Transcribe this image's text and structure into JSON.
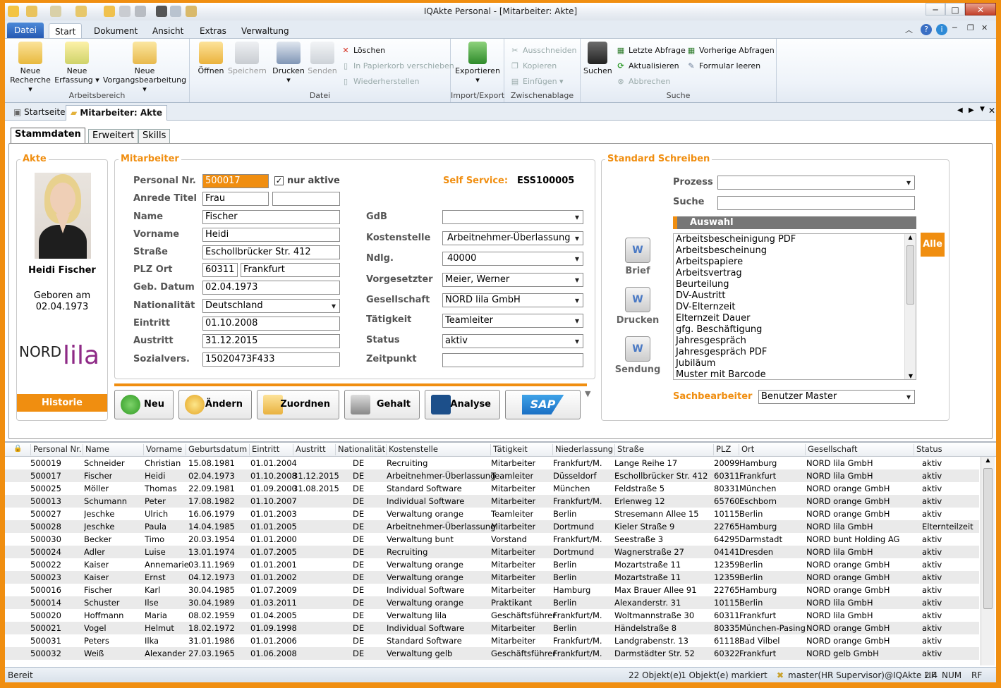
{
  "window": {
    "title": "IQAkte Personal - [Mitarbeiter: Akte]"
  },
  "ribbon_tabs": [
    "Datei",
    "Start",
    "Dokument",
    "Ansicht",
    "Extras",
    "Verwaltung"
  ],
  "ribbon": {
    "arbeitsbereich": {
      "label": "Arbeitsbereich",
      "neue_recherche": [
        "Neue",
        "Recherche"
      ],
      "neue_erfassung": [
        "Neue",
        "Erfassung"
      ],
      "neue_vorgang": [
        "Neue",
        "Vorgangsbearbeitung"
      ]
    },
    "datei": {
      "label": "Datei",
      "oeffnen": "Öffnen",
      "speichern": "Speichern",
      "drucken": "Drucken",
      "senden": "Senden",
      "loeschen": "Löschen",
      "papierkorb": "In Papierkorb verschieben",
      "wiederherstellen": "Wiederherstellen"
    },
    "import": {
      "label": "Import/Export",
      "exportieren": "Exportieren"
    },
    "zwischenablage": {
      "label": "Zwischenablage",
      "ausschneiden": "Ausschneiden",
      "kopieren": "Kopieren",
      "einfuegen": "Einfügen"
    },
    "suche": {
      "label": "Suche",
      "suchen": "Suchen",
      "letzte": "Letzte Abfrage",
      "aktualisieren": "Aktualisieren",
      "abbrechen": "Abbrechen",
      "vorherige": "Vorherige Abfragen",
      "leeren": "Formular leeren"
    }
  },
  "doc_tabs": [
    "Startseite",
    "Mitarbeiter: Akte"
  ],
  "sub_tabs": [
    "Stammdaten",
    "Erweitert",
    "Skills"
  ],
  "akte": {
    "title": "Akte",
    "name": "Heidi Fischer",
    "born_label": "Geboren am",
    "born_date": "02.04.1973",
    "logo_a": "NORD",
    "logo_b": "lila",
    "historie": "Historie"
  },
  "mitarbeiter": {
    "title": "Mitarbeiter",
    "labels": {
      "pnr": "Personal Nr.",
      "anrede": "Anrede Titel",
      "name": "Name",
      "vorname": "Vorname",
      "strasse": "Straße",
      "plz": "PLZ Ort",
      "geb": "Geb. Datum",
      "nat": "Nationalität",
      "eintritt": "Eintritt",
      "austritt": "Austritt",
      "sv": "Sozialvers.",
      "gdb": "GdB",
      "kst": "Kostenstelle",
      "ndlg": "Ndlg.",
      "vorg": "Vorgesetzter",
      "ges": "Gesellschaft",
      "taet": "Tätigkeit",
      "status": "Status",
      "zeit": "Zeitpunkt",
      "nur_aktive": "nur aktive",
      "self_service": "Self Service:"
    },
    "values": {
      "pnr": "500017",
      "anrede": "Frau",
      "titel": "",
      "name": "Fischer",
      "vorname": "Heidi",
      "strasse": "Eschollbrücker Str. 412",
      "plz": "60311",
      "ort": "Frankfurt",
      "geb": "02.04.1973",
      "nat": "Deutschland",
      "eintritt": "01.10.2008",
      "austritt": "31.12.2015",
      "sv": "15020473F433",
      "gdb": "",
      "kst": "Arbeitnehmer-Überlassung",
      "ndlg": "40000",
      "vorg": "Meier, Werner",
      "ges": "NORD lila GmbH",
      "taet": "Teamleiter",
      "status": "aktiv",
      "zeit": "",
      "ess": "ESS100005"
    }
  },
  "actions": {
    "neu": "Neu",
    "aendern": "Ändern",
    "zuordnen": "Zuordnen",
    "gehalt": "Gehalt",
    "analyse": "Analyse",
    "sap": "SAP"
  },
  "schreiben": {
    "title": "Standard Schreiben",
    "prozess_label": "Prozess",
    "suche_label": "Suche",
    "auswahl": "Auswahl",
    "alle": "Alle",
    "brief": "Brief",
    "drucken": "Drucken",
    "sendung": "Sendung",
    "sb_label": "Sachbearbeiter",
    "sb_value": "Benutzer Master",
    "items": [
      "Arbeitsbescheinigung PDF",
      "Arbeitsbescheinung",
      "Arbeitspapiere",
      "Arbeitsvertrag",
      "Beurteilung",
      "DV-Austritt",
      "DV-Elternzeit",
      "Elternzeit Dauer",
      "gfg. Beschäftigung",
      "Jahresgespräch",
      "Jahresgespräch PDF",
      "Jubiläum",
      "Muster mit Barcode"
    ]
  },
  "grid": {
    "columns": [
      "Personal Nr.",
      "Name",
      "Vorname",
      "Geburtsdatum",
      "Eintritt",
      "Austritt",
      "Nationalität",
      "Kostenstelle",
      "Tätigkeit",
      "Niederlassung",
      "Straße",
      "PLZ",
      "Ort",
      "Gesellschaft",
      "Status"
    ],
    "rows": [
      [
        "500019",
        "Schneider",
        "Christian",
        "15.08.1981",
        "01.01.2004",
        "",
        "DE",
        "Recruiting",
        "Mitarbeiter",
        "Frankfurt/M.",
        "Lange Reihe 17",
        "20099",
        "Hamburg",
        "NORD lila GmbH",
        "aktiv"
      ],
      [
        "500017",
        "Fischer",
        "Heidi",
        "02.04.1973",
        "01.10.2008",
        "31.12.2015",
        "DE",
        "Arbeitnehmer-Überlassung",
        "Teamleiter",
        "Düsseldorf",
        "Eschollbrücker Str. 412",
        "60311",
        "Frankfurt",
        "NORD lila GmbH",
        "aktiv"
      ],
      [
        "500025",
        "Möller",
        "Thomas",
        "22.09.1981",
        "01.09.2000",
        "31.08.2015",
        "DE",
        "Standard Software",
        "Mitarbeiter",
        "München",
        "Feldstraße 5",
        "80331",
        "München",
        "NORD orange GmbH",
        "aktiv"
      ],
      [
        "500013",
        "Schumann",
        "Peter",
        "17.08.1982",
        "01.10.2007",
        "",
        "DE",
        "Individual Software",
        "Mitarbeiter",
        "Frankfurt/M.",
        "Erlenweg 12",
        "65760",
        "Eschborn",
        "NORD orange GmbH",
        "aktiv"
      ],
      [
        "500027",
        "Jeschke",
        "Ulrich",
        "16.06.1979",
        "01.01.2003",
        "",
        "DE",
        "Verwaltung orange",
        "Teamleiter",
        "Berlin",
        "Stresemann Allee 15",
        "10115",
        "Berlin",
        "NORD orange GmbH",
        "aktiv"
      ],
      [
        "500028",
        "Jeschke",
        "Paula",
        "14.04.1985",
        "01.01.2005",
        "",
        "DE",
        "Arbeitnehmer-Überlassung",
        "Mitarbeiter",
        "Dortmund",
        "Kieler Straße 9",
        "22765",
        "Hamburg",
        "NORD lila GmbH",
        "Elternteilzeit"
      ],
      [
        "500030",
        "Becker",
        "Timo",
        "20.03.1954",
        "01.01.2000",
        "",
        "DE",
        "Verwaltung bunt",
        "Vorstand",
        "Frankfurt/M.",
        "Seestraße 3",
        "64295",
        "Darmstadt",
        "NORD bunt Holding AG",
        "aktiv"
      ],
      [
        "500024",
        "Adler",
        "Luise",
        "13.01.1974",
        "01.07.2005",
        "",
        "DE",
        "Recruiting",
        "Mitarbeiter",
        "Dortmund",
        "Wagnerstraße 27",
        "04141",
        "Dresden",
        "NORD lila GmbH",
        "aktiv"
      ],
      [
        "500022",
        "Kaiser",
        "Annemarie",
        "03.11.1969",
        "01.01.2001",
        "",
        "DE",
        "Verwaltung orange",
        "Mitarbeiter",
        "Berlin",
        "Mozartstraße 11",
        "12359",
        "Berlin",
        "NORD orange GmbH",
        "aktiv"
      ],
      [
        "500023",
        "Kaiser",
        "Ernst",
        "04.12.1973",
        "01.01.2002",
        "",
        "DE",
        "Verwaltung orange",
        "Mitarbeiter",
        "Berlin",
        "Mozartstraße 11",
        "12359",
        "Berlin",
        "NORD orange GmbH",
        "aktiv"
      ],
      [
        "500016",
        "Fischer",
        "Karl",
        "30.04.1985",
        "01.07.2009",
        "",
        "DE",
        "Individual Software",
        "Mitarbeiter",
        "Hamburg",
        "Max Brauer Allee 91",
        "22765",
        "Hamburg",
        "NORD orange GmbH",
        "aktiv"
      ],
      [
        "500014",
        "Schuster",
        "Ilse",
        "30.04.1989",
        "01.03.2011",
        "",
        "DE",
        "Verwaltung orange",
        "Praktikant",
        "Berlin",
        "Alexanderstr. 31",
        "10115",
        "Berlin",
        "NORD lila GmbH",
        "aktiv"
      ],
      [
        "500020",
        "Hoffmann",
        "Maria",
        "08.02.1959",
        "01.04.2005",
        "",
        "DE",
        "Verwaltung lila",
        "Geschäftsführer",
        "Frankfurt/M.",
        "Woltmannstraße 30",
        "60311",
        "Frankfurt",
        "NORD lila GmbH",
        "aktiv"
      ],
      [
        "500021",
        "Vogel",
        "Helmut",
        "18.02.1972",
        "01.09.1998",
        "",
        "DE",
        "Individual Software",
        "Mitarbeiter",
        "Berlin",
        "Händelstraße 8",
        "80335",
        "München-Pasing",
        "NORD orange GmbH",
        "aktiv"
      ],
      [
        "500031",
        "Peters",
        "Ilka",
        "31.01.1986",
        "01.01.2006",
        "",
        "DE",
        "Standard Software",
        "Mitarbeiter",
        "Frankfurt/M.",
        "Landgrabenstr. 13",
        "61118",
        "Bad Vilbel",
        "NORD orange GmbH",
        "aktiv"
      ],
      [
        "500032",
        "Weiß",
        "Alexander",
        "27.03.1965",
        "01.06.2008",
        "",
        "DE",
        "Verwaltung gelb",
        "Geschäftsführer",
        "Frankfurt/M.",
        "Darmstädter Str. 52",
        "60322",
        "Frankfurt",
        "NORD gelb GmbH",
        "aktiv"
      ]
    ]
  },
  "status": {
    "left": "Bereit",
    "count": "22 Objekt(e)",
    "marked": "1 Objekt(e) markiert",
    "user": "master(HR Supervisor)@IQAkte 2.4",
    "uf": "UF",
    "num": "NUM",
    "rf": "RF"
  }
}
